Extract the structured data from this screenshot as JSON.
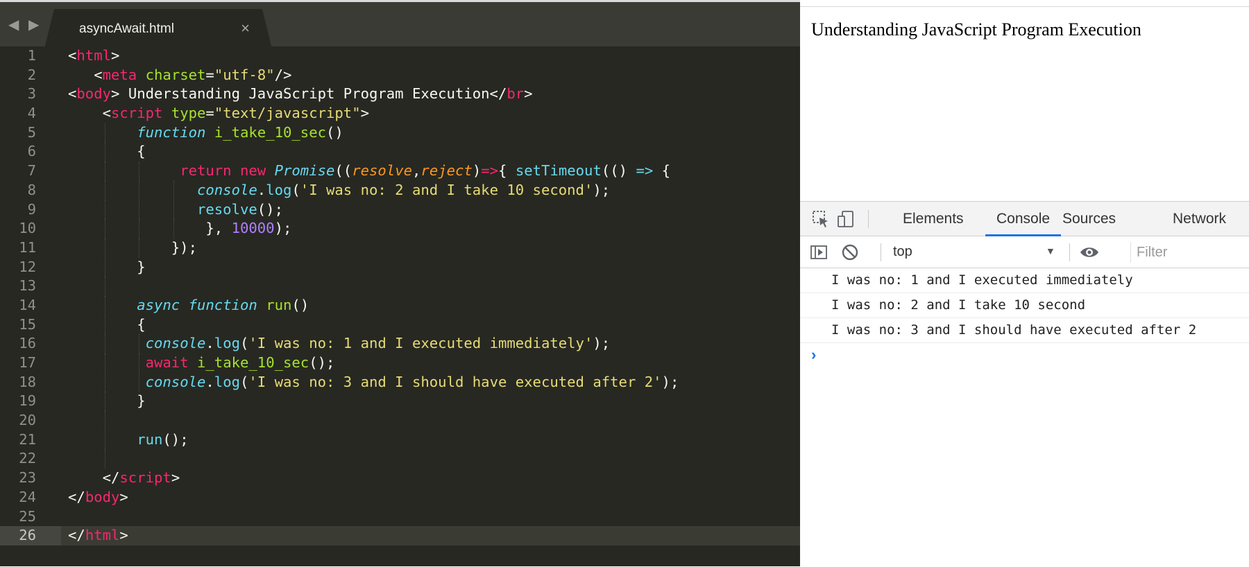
{
  "editor": {
    "tab_title": "asyncAwait.html",
    "tab_close": "×",
    "nav_arrows": "◀ ▶",
    "lines": [
      {
        "n": "1"
      },
      {
        "n": "2"
      },
      {
        "n": "3"
      },
      {
        "n": "4"
      },
      {
        "n": "5"
      },
      {
        "n": "6"
      },
      {
        "n": "7"
      },
      {
        "n": "8"
      },
      {
        "n": "9"
      },
      {
        "n": "10"
      },
      {
        "n": "11"
      },
      {
        "n": "12"
      },
      {
        "n": "13"
      },
      {
        "n": "14"
      },
      {
        "n": "15"
      },
      {
        "n": "16"
      },
      {
        "n": "17"
      },
      {
        "n": "18"
      },
      {
        "n": "19"
      },
      {
        "n": "20"
      },
      {
        "n": "21"
      },
      {
        "n": "22"
      },
      {
        "n": "23"
      },
      {
        "n": "24"
      },
      {
        "n": "25"
      },
      {
        "n": "26"
      }
    ],
    "code": [
      [
        [
          "p",
          "<"
        ],
        [
          "t",
          "html"
        ],
        [
          "p",
          ">"
        ]
      ],
      [
        [
          "p",
          "   <"
        ],
        [
          "t",
          "meta"
        ],
        [
          "p",
          " "
        ],
        [
          "a",
          "charset"
        ],
        [
          "p",
          "="
        ],
        [
          "s",
          "\"utf-8\""
        ],
        [
          "p",
          "/>"
        ]
      ],
      [
        [
          "p",
          "<"
        ],
        [
          "t",
          "body"
        ],
        [
          "p",
          "> Understanding JavaScript Program Execution</"
        ],
        [
          "t",
          "br"
        ],
        [
          "p",
          ">"
        ]
      ],
      [
        [
          "p",
          "    <"
        ],
        [
          "t",
          "script"
        ],
        [
          "p",
          " "
        ],
        [
          "a",
          "type"
        ],
        [
          "p",
          "="
        ],
        [
          "s",
          "\"text/javascript\""
        ],
        [
          "p",
          ">"
        ]
      ],
      [
        [
          "p",
          "        "
        ],
        [
          "st",
          "function"
        ],
        [
          "p",
          " "
        ],
        [
          "a",
          "i_take_10_sec"
        ],
        [
          "p",
          "()"
        ]
      ],
      [
        [
          "p",
          "        {"
        ]
      ],
      [
        [
          "p",
          "             "
        ],
        [
          "t",
          "return"
        ],
        [
          "p",
          " "
        ],
        [
          "t",
          "new"
        ],
        [
          "p",
          " "
        ],
        [
          "st",
          "Promise"
        ],
        [
          "p",
          "(("
        ],
        [
          "pa",
          "resolve"
        ],
        [
          "p",
          ","
        ],
        [
          "pa",
          "reject"
        ],
        [
          "p",
          ")"
        ],
        [
          "t",
          "=>"
        ],
        [
          "p",
          "{ "
        ],
        [
          "sf",
          "setTimeout"
        ],
        [
          "p",
          "(() "
        ],
        [
          "st",
          "=>"
        ],
        [
          "p",
          " {"
        ]
      ],
      [
        [
          "p",
          "               "
        ],
        [
          "st",
          "console"
        ],
        [
          "p",
          "."
        ],
        [
          "sf",
          "log"
        ],
        [
          "p",
          "("
        ],
        [
          "s",
          "'I was no: 2 and I take 10 second'"
        ],
        [
          "p",
          ");"
        ]
      ],
      [
        [
          "p",
          "               "
        ],
        [
          "sf",
          "resolve"
        ],
        [
          "p",
          "();"
        ]
      ],
      [
        [
          "p",
          "                }, "
        ],
        [
          "n",
          "10000"
        ],
        [
          "p",
          ");"
        ]
      ],
      [
        [
          "p",
          "            });"
        ]
      ],
      [
        [
          "p",
          "        }"
        ]
      ],
      [
        [
          "p",
          ""
        ]
      ],
      [
        [
          "p",
          "        "
        ],
        [
          "st",
          "async"
        ],
        [
          "p",
          " "
        ],
        [
          "st",
          "function"
        ],
        [
          "p",
          " "
        ],
        [
          "a",
          "run"
        ],
        [
          "p",
          "()"
        ]
      ],
      [
        [
          "p",
          "        {"
        ]
      ],
      [
        [
          "p",
          "         "
        ],
        [
          "st",
          "console"
        ],
        [
          "p",
          "."
        ],
        [
          "sf",
          "log"
        ],
        [
          "p",
          "("
        ],
        [
          "s",
          "'I was no: 1 and I executed immediately'"
        ],
        [
          "p",
          ");"
        ]
      ],
      [
        [
          "p",
          "         "
        ],
        [
          "t",
          "await"
        ],
        [
          "p",
          " "
        ],
        [
          "a",
          "i_take_10_sec"
        ],
        [
          "p",
          "();"
        ]
      ],
      [
        [
          "p",
          "         "
        ],
        [
          "st",
          "console"
        ],
        [
          "p",
          "."
        ],
        [
          "sf",
          "log"
        ],
        [
          "p",
          "("
        ],
        [
          "s",
          "'I was no: 3 and I should have executed after 2'"
        ],
        [
          "p",
          ");"
        ]
      ],
      [
        [
          "p",
          "        }"
        ]
      ],
      [
        [
          "p",
          ""
        ]
      ],
      [
        [
          "p",
          "        "
        ],
        [
          "sf",
          "run"
        ],
        [
          "p",
          "();"
        ]
      ],
      [
        [
          "p",
          ""
        ]
      ],
      [
        [
          "p",
          "    </"
        ],
        [
          "t",
          "script"
        ],
        [
          "p",
          ">"
        ]
      ],
      [
        [
          "p",
          "</"
        ],
        [
          "t",
          "body"
        ],
        [
          "p",
          ">"
        ]
      ],
      [
        [
          "p",
          ""
        ]
      ],
      [
        [
          "p",
          "</"
        ],
        [
          "t",
          "html"
        ],
        [
          "p",
          ">"
        ]
      ]
    ],
    "current_line": 26
  },
  "browser": {
    "page_heading": "Understanding JavaScript Program Execution"
  },
  "devtools": {
    "tabs": [
      {
        "label": "Elements"
      },
      {
        "label": "Console",
        "active": true
      },
      {
        "label": "Sources"
      },
      {
        "label": "Network"
      }
    ],
    "context": "top",
    "filter_placeholder": "Filter",
    "console_messages": [
      "I was no: 1 and I executed immediately",
      "I was no: 2 and I take 10 second",
      "I was no: 3 and I should have executed after 2"
    ],
    "prompt": "›"
  },
  "colors": {
    "editor_bg": "#272822",
    "tag": "#f92672",
    "attr": "#a6e22e",
    "string": "#e6db74",
    "storage": "#66d9ef",
    "param": "#fd971f",
    "number": "#ae81ff",
    "devtools_accent": "#1a73e8"
  }
}
